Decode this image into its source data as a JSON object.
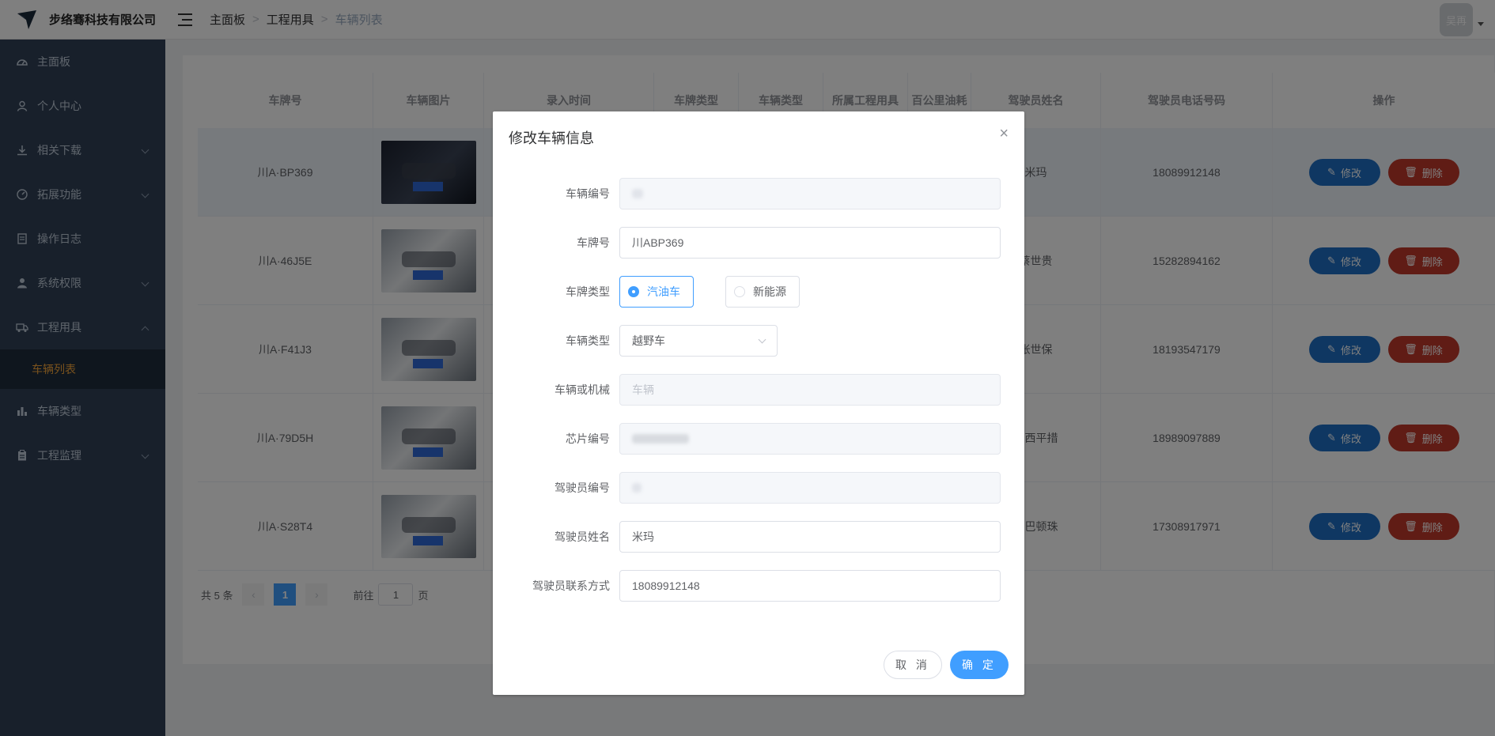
{
  "brand": {
    "name": "步络骞科技有限公司"
  },
  "breadcrumb": [
    "主面板",
    "工程用具",
    "车辆列表"
  ],
  "user": {
    "avatar_text": "吴再"
  },
  "sidebar": {
    "items": [
      {
        "label": "主面板",
        "icon": "dashboard-icon",
        "arrow": "none"
      },
      {
        "label": "个人中心",
        "icon": "user-icon",
        "arrow": "none"
      },
      {
        "label": "相关下载",
        "icon": "download-icon",
        "arrow": "down"
      },
      {
        "label": "拓展功能",
        "icon": "gauge-icon",
        "arrow": "down"
      },
      {
        "label": "操作日志",
        "icon": "document-icon",
        "arrow": "none"
      },
      {
        "label": "系统权限",
        "icon": "person-icon",
        "arrow": "down"
      },
      {
        "label": "工程用具",
        "icon": "truck-icon",
        "arrow": "up"
      },
      {
        "label": "车辆类型",
        "icon": "bar-chart-icon",
        "arrow": "none"
      },
      {
        "label": "工程监理",
        "icon": "clipboard-icon",
        "arrow": "down"
      }
    ],
    "active_sub": "车辆列表"
  },
  "table": {
    "headers": [
      "车牌号",
      "车辆图片",
      "录入时间",
      "车牌类型",
      "车辆类型",
      "所属工程用具",
      "百公里油耗",
      "驾驶员姓名",
      "驾驶员电话号码",
      "操作"
    ],
    "rows": [
      {
        "plate": "川A·BP369",
        "driver": "米玛",
        "phone": "18089912148",
        "img": "dark"
      },
      {
        "plate": "川A·46J5E",
        "driver": "蔡世贵",
        "phone": "15282894162",
        "img": "light"
      },
      {
        "plate": "川A·F41J3",
        "driver": "张世保",
        "phone": "18193547179",
        "img": "light"
      },
      {
        "plate": "川A·79D5H",
        "driver": "益西平措",
        "phone": "18989097889",
        "img": "light"
      },
      {
        "plate": "川A·S28T4",
        "driver": "扎巴顿珠",
        "phone": "17308917971",
        "img": "light"
      }
    ],
    "edit_label": "修改",
    "delete_label": "删除"
  },
  "pager": {
    "total": "共 5 条",
    "current": "1",
    "goto": "前往",
    "page_value": "1",
    "page_unit": "页"
  },
  "dialog": {
    "title": "修改车辆信息",
    "fields": {
      "vehicle_no_label": "车辆编号",
      "plate_label": "车牌号",
      "plate_value": "川ABP369",
      "plate_type_label": "车牌类型",
      "plate_type_options": [
        "汽油车",
        "新能源"
      ],
      "plate_type_selected": "汽油车",
      "vehicle_type_label": "车辆类型",
      "vehicle_type_value": "越野车",
      "kind_label": "车辆或机械",
      "kind_value": "车辆",
      "chip_label": "芯片编号",
      "driver_no_label": "驾驶员编号",
      "driver_name_label": "驾驶员姓名",
      "driver_name_value": "米玛",
      "driver_phone_label": "驾驶员联系方式",
      "driver_phone_value": "18089912148"
    },
    "cancel_label": "取 消",
    "ok_label": "确 定"
  },
  "colors": {
    "primary": "#409eff",
    "sidebar_bg": "#304156",
    "active_sub": "#f4a53a",
    "danger": "#c0392b"
  }
}
